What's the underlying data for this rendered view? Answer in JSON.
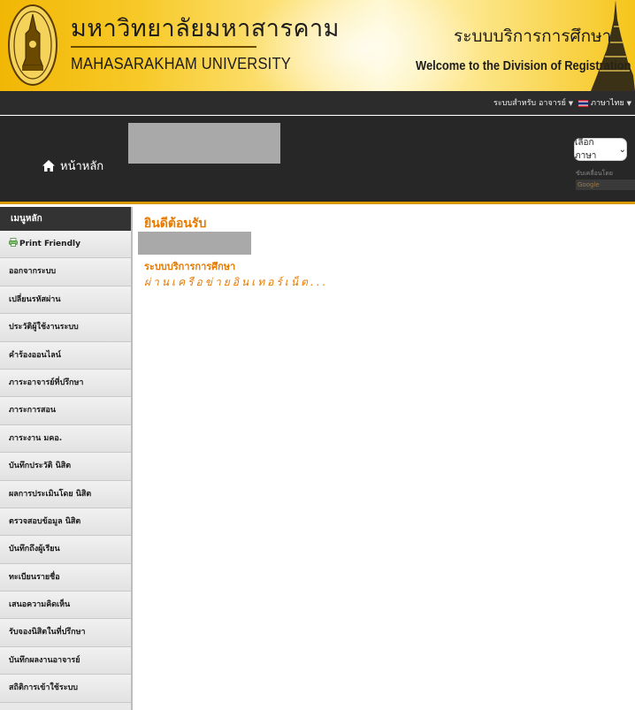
{
  "banner": {
    "university_thai": "มหาวิทยาลัยมหาสารคาม",
    "university_en": "MAHASARAKHAM UNIVERSITY",
    "system_thai": "ระบบบริการการศึกษา",
    "system_en": "Welcome to the Division of Registration"
  },
  "topbar": {
    "role_menu": "ระบบสำหรับ อาจารย์",
    "language_menu": "ภาษาไทย",
    "caret": "▼"
  },
  "nav": {
    "home_label": "หน้าหลัก",
    "language_select": "เลือกภาษา",
    "language_chevron": "⌄",
    "powered_by": "ขับเคลื่อนโดย",
    "google_label": "Google"
  },
  "sidebar": {
    "header": "เมนูหลัก",
    "items": [
      {
        "label": "Print Friendly",
        "icon": "printer-icon"
      },
      {
        "label": "ออกจากระบบ"
      },
      {
        "label": "เปลี่ยนรหัสผ่าน"
      },
      {
        "label": "ประวัติผู้ใช้งานระบบ"
      },
      {
        "label": "คำร้องออนไลน์"
      },
      {
        "label": "ภาระอาจารย์ที่ปรึกษา"
      },
      {
        "label": "ภาระการสอน"
      },
      {
        "label": "ภาระงาน มคอ."
      },
      {
        "label": "บันทึกประวัติ นิสิต"
      },
      {
        "label": "ผลการประเมินโดย นิสิต"
      },
      {
        "label": "ตรวจสอบข้อมูล นิสิต"
      },
      {
        "label": "บันทึกถึงผู้เรียน"
      },
      {
        "label": "ทะเบียนรายชื่อ"
      },
      {
        "label": "เสนอความคิดเห็น"
      },
      {
        "label": "รับจองนิสิตในที่ปรึกษา"
      },
      {
        "label": "บันทึกผลงานอาจารย์"
      },
      {
        "label": "สถิติการเข้าใช้ระบบ"
      }
    ]
  },
  "content": {
    "welcome": "ยินดีต้อนรับ",
    "system_label": "ระบบบริการการศึกษา",
    "via_text": "ผ่านเครือข่ายอินเทอร์เน็ต..."
  },
  "colors": {
    "banner_gold": "#f2b705",
    "nav_dark": "#272727",
    "accent_orange": "#e57a00",
    "sidebar_bg": "#e8e8e8"
  }
}
